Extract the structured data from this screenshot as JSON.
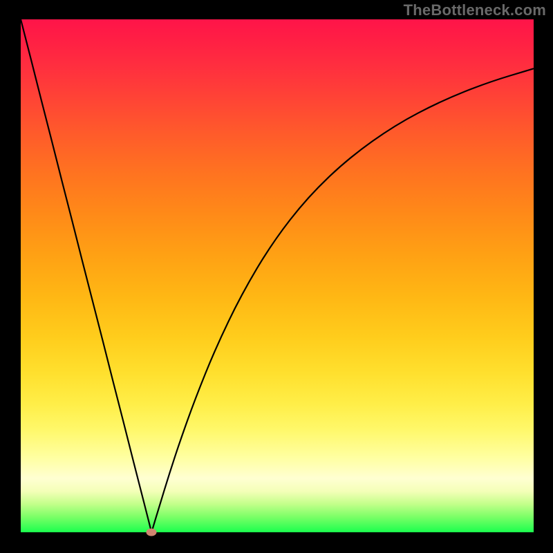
{
  "watermark": "TheBottleneck.com",
  "chart_data": {
    "type": "line",
    "title": "",
    "xlabel": "",
    "ylabel": "",
    "xlim": [
      0,
      100
    ],
    "ylim": [
      0,
      100
    ],
    "x": [
      0,
      2,
      4,
      6,
      8,
      10,
      12,
      14,
      16,
      18,
      20,
      22,
      24,
      25.5,
      27,
      29,
      31,
      34,
      38,
      43,
      49,
      56,
      64,
      73,
      82,
      91,
      100
    ],
    "values": [
      100,
      92.2,
      84.3,
      76.5,
      68.6,
      60.8,
      52.9,
      45.1,
      37.3,
      29.4,
      21.6,
      13.7,
      5.9,
      0,
      5,
      11.5,
      17.6,
      26,
      35.9,
      46.3,
      56.4,
      65.4,
      73.0,
      79.4,
      84.1,
      87.7,
      90.4
    ],
    "marker": {
      "x": 25.5,
      "y": 0
    }
  },
  "colors": {
    "curve": "#000000",
    "marker": "#cf8570",
    "gradient_top": "#ff1449",
    "gradient_bottom": "#1bff4e",
    "frame": "#000000"
  }
}
